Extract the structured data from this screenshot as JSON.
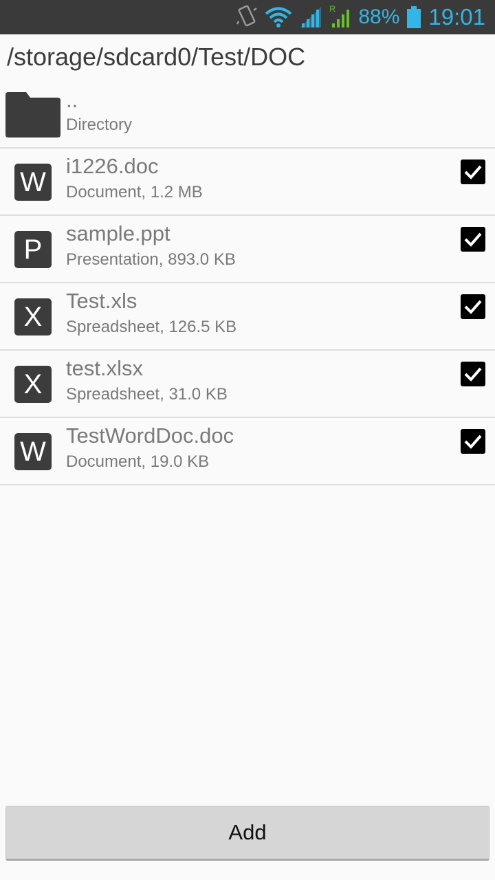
{
  "status_bar": {
    "icons": [
      "vibrate-icon",
      "wifi-icon",
      "signal-icon",
      "roaming-signal-icon",
      "battery-icon"
    ],
    "roaming_label": "R",
    "battery_percent": "88%",
    "time": "19:01",
    "accent_color": "#33b5e5"
  },
  "path": "/storage/sdcard0/Test/DOC",
  "parent": {
    "name": "..",
    "type": "Directory",
    "icon": "folder-icon"
  },
  "files": [
    {
      "icon_letter": "W",
      "name": "i1226.doc",
      "details": "Document, 1.2 MB",
      "checked": true
    },
    {
      "icon_letter": "P",
      "name": "sample.ppt",
      "details": "Presentation, 893.0 KB",
      "checked": true
    },
    {
      "icon_letter": "X",
      "name": "Test.xls",
      "details": "Spreadsheet, 126.5 KB",
      "checked": true
    },
    {
      "icon_letter": "X",
      "name": "test.xlsx",
      "details": "Spreadsheet, 31.0 KB",
      "checked": true
    },
    {
      "icon_letter": "W",
      "name": "TestWordDoc.doc",
      "details": "Document, 19.0 KB",
      "checked": true
    }
  ],
  "add_button_label": "Add"
}
